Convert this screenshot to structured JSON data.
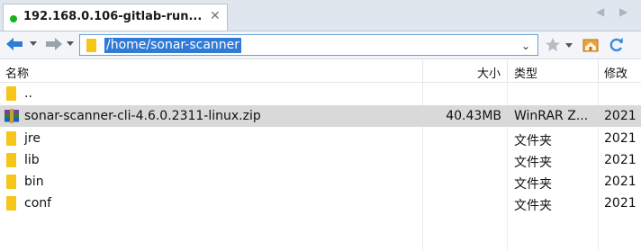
{
  "tab": {
    "title": "192.168.0.106-gitlab-run...",
    "close_glyph": "✕",
    "prev_glyph": "◀",
    "next_glyph": "▶",
    "status_color": "#17b21a"
  },
  "toolbar": {
    "back_icon": "back-arrow-icon",
    "forward_icon": "forward-arrow-icon",
    "address": "/home/sonar-scanner",
    "address_dropdown_glyph": "⌄",
    "bookmark_icon": "star-icon",
    "home_icon": "home-icon",
    "refresh_icon": "refresh-icon"
  },
  "columns": {
    "name": "名称",
    "size": "大小",
    "type": "类型",
    "modified": "修改"
  },
  "files": [
    {
      "name": "..",
      "size": "",
      "type": "",
      "modified": "",
      "icon": "folder-icon"
    },
    {
      "name": "sonar-scanner-cli-4.6.0.2311-linux.zip",
      "size": "40.43MB",
      "type": "WinRAR Z...",
      "modified": "2021",
      "icon": "winrar-archive-icon",
      "selected": true
    },
    {
      "name": "jre",
      "size": "",
      "type": "文件夹",
      "modified": "2021",
      "icon": "folder-icon"
    },
    {
      "name": "lib",
      "size": "",
      "type": "文件夹",
      "modified": "2021",
      "icon": "folder-icon"
    },
    {
      "name": "bin",
      "size": "",
      "type": "文件夹",
      "modified": "2021",
      "icon": "folder-icon"
    },
    {
      "name": "conf",
      "size": "",
      "type": "文件夹",
      "modified": "2021",
      "icon": "folder-icon"
    }
  ],
  "colors": {
    "accent": "#2f7bd6",
    "selection": "#d9d9d9",
    "folder": "#f5c518"
  }
}
